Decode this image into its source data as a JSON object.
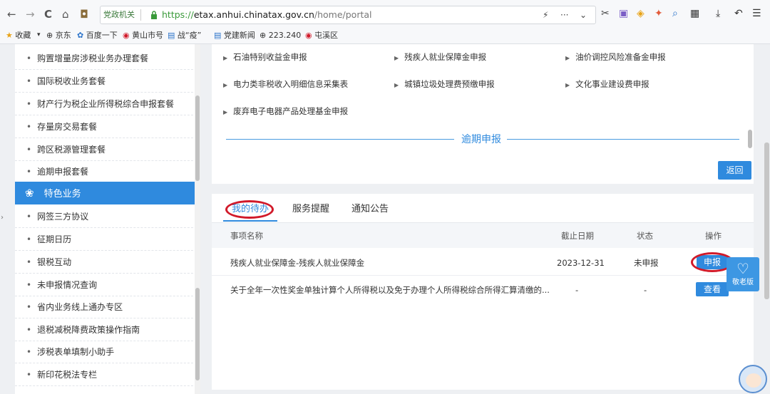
{
  "browser": {
    "nav": {
      "back": "←",
      "forward": "→",
      "reload": "C",
      "home": "⌂",
      "wallet": "◘"
    },
    "site_label": "党政机关",
    "url_scheme": "https://",
    "url_host": "etax.anhui.chinatax.gov.cn",
    "url_path": "/home/portal",
    "url_right_icons": [
      "⚡",
      "···",
      "⌄"
    ],
    "toolbar_icons": [
      "✂",
      "▣",
      "◈",
      "✦",
      "⌕",
      "▦",
      "⤓",
      "↶",
      "☰"
    ],
    "bookmarks": [
      {
        "icon": "★",
        "label": "收藏"
      },
      {
        "icon": "▾",
        "label": ""
      },
      {
        "icon": "⊕",
        "label": "京东"
      },
      {
        "icon": "✿",
        "label": "百度一下"
      },
      {
        "icon": "◉",
        "label": "黄山市号"
      },
      {
        "icon": "▤",
        "label": "战“疫”"
      },
      {
        "icon": "▤",
        "label": "党建新闻"
      },
      {
        "icon": "⊕",
        "label": "223.240"
      },
      {
        "icon": "◉",
        "label": "屯溪区"
      }
    ]
  },
  "sidebar": {
    "items_top": [
      "购置增量房涉税业务办理套餐",
      "国际税收业务套餐",
      "财产行为税企业所得税综合申报套餐",
      "存量房交易套餐",
      "跨区税源管理套餐",
      "逾期申报套餐"
    ],
    "section_icon": "❀",
    "section_title": "特色业务",
    "items_bottom": [
      "网签三方协议",
      "征期日历",
      "银税互动",
      "未申报情况查询",
      "省内业务线上通办专区",
      "退税减税降费政策操作指南",
      "涉税表单填制小助手",
      "新印花税法专栏"
    ]
  },
  "top_panel": {
    "links": [
      "石油特别收益金申报",
      "残疾人就业保障金申报",
      "油价调控风险准备金申报",
      "电力类非税收入明细信息采集表",
      "城镇垃圾处理费预缴申报",
      "文化事业建设费申报",
      "废弃电子电器产品处理基金申报"
    ],
    "divider_title": "逾期申报",
    "back_button": "返回"
  },
  "bottom_panel": {
    "tabs": [
      "我的待办",
      "服务提醒",
      "通知公告"
    ],
    "headers": {
      "name": "事项名称",
      "date": "截止日期",
      "status": "状态",
      "action": "操作"
    },
    "rows": [
      {
        "name": "残疾人就业保障金-残疾人就业保障金",
        "date": "2023-12-31",
        "status": "未申报",
        "action": "申报"
      },
      {
        "name": "关于全年一次性奖金单独计算个人所得税以及免于办理个人所得税综合所得汇算清缴的...",
        "date": "-",
        "status": "-",
        "action": "查看"
      }
    ]
  },
  "float_button": {
    "icon": "♡",
    "label": "敬老版"
  },
  "accent_color": "#2f8ade",
  "highlight_color": "#d11a2a"
}
